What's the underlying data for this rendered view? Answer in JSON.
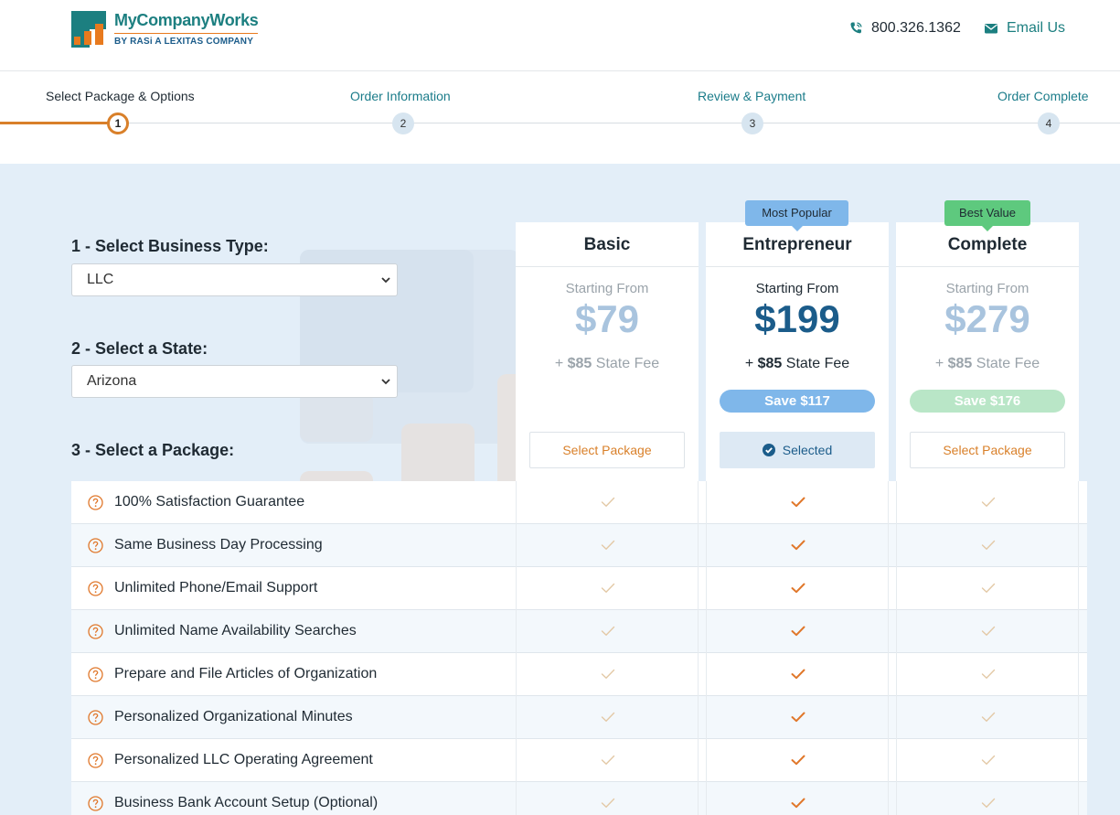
{
  "brand": {
    "name_part1": "MyCompany",
    "name_part2": "Works",
    "sub_by": "BY",
    "sub_rasi": "RASi",
    "sub_rest": "A LEXITAS COMPANY",
    "colors": {
      "teal": "#1c7f80",
      "orange": "#e87a1e",
      "navy": "#1b5c8a"
    }
  },
  "header": {
    "phone": "800.326.1362",
    "email_label": "Email Us"
  },
  "steps": [
    {
      "label": "Select Package & Options",
      "number": "1",
      "active": true
    },
    {
      "label": "Order Information",
      "number": "2",
      "active": false
    },
    {
      "label": "Review & Payment",
      "number": "3",
      "active": false
    },
    {
      "label": "Order Complete",
      "number": "4",
      "active": false
    }
  ],
  "form": {
    "business_type_label": "1 - Select Business Type:",
    "business_type_value": "LLC",
    "state_label": "2 - Select a State:",
    "state_value": "Arizona",
    "package_label": "3 - Select a Package:"
  },
  "packages": [
    {
      "name": "Basic",
      "starting_from": "Starting From",
      "price": "$79",
      "fee_prefix": "+",
      "fee_amount": "$85",
      "fee_suffix": "State Fee",
      "save": "",
      "button": "Select Package",
      "badge": ""
    },
    {
      "name": "Entrepreneur",
      "starting_from": "Starting From",
      "price": "$199",
      "fee_prefix": "+",
      "fee_amount": "$85",
      "fee_suffix": "State Fee",
      "save": "Save $117",
      "button": "Selected",
      "badge": "Most Popular"
    },
    {
      "name": "Complete",
      "starting_from": "Starting From",
      "price": "$279",
      "fee_prefix": "+",
      "fee_amount": "$85",
      "fee_suffix": "State Fee",
      "save": "Save $176",
      "button": "Select Package",
      "badge": "Best Value"
    }
  ],
  "features": [
    "100% Satisfaction Guarantee",
    "Same Business Day Processing",
    "Unlimited Phone/Email Support",
    "Unlimited Name Availability Searches",
    "Prepare and File Articles of Organization",
    "Personalized Organizational Minutes",
    "Personalized LLC Operating Agreement",
    "Business Bank Account Setup (Optional)"
  ],
  "icons": {
    "phone": "phone-icon",
    "email": "envelope-icon",
    "help": "question-circle-icon",
    "check": "checkmark-icon",
    "selected": "check-circle-icon",
    "dropdown": "chevron-down-icon"
  }
}
